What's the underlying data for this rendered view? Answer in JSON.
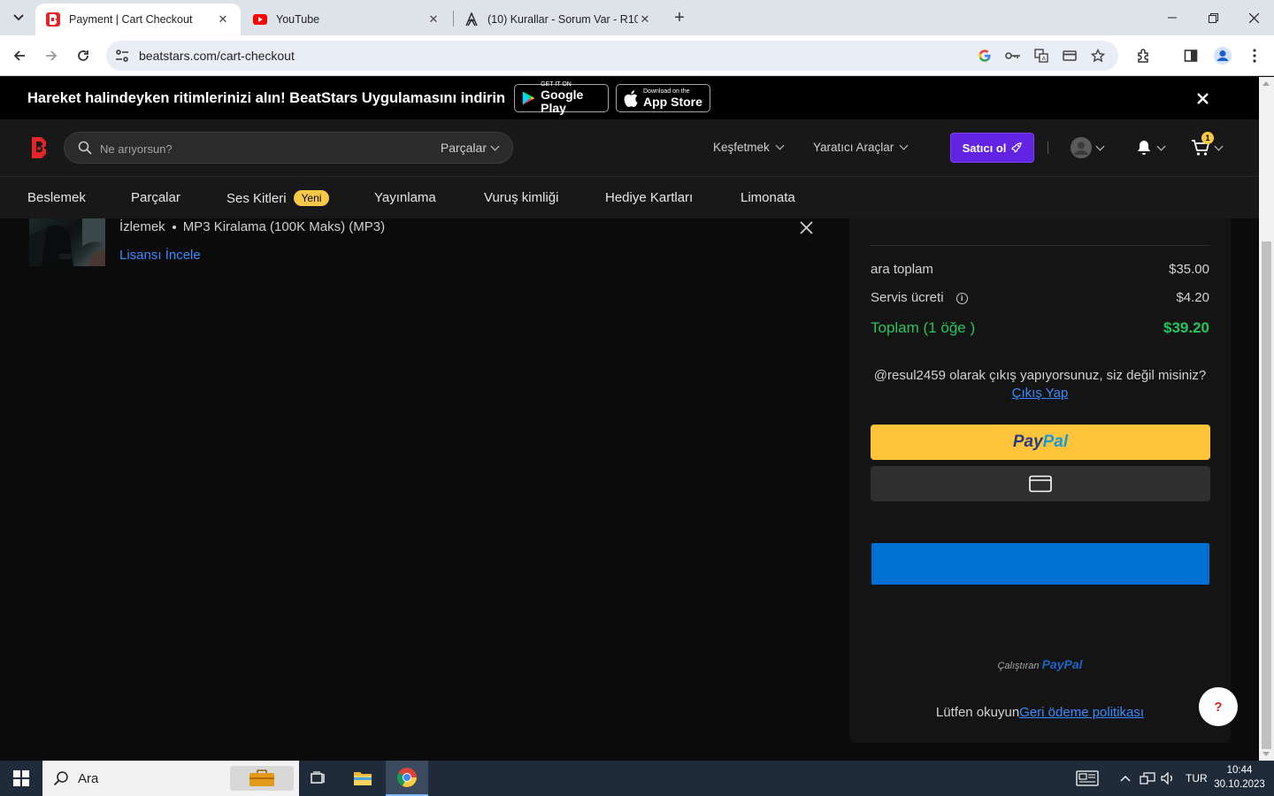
{
  "browser": {
    "tabs": [
      {
        "title": "Payment | Cart Checkout",
        "active": true
      },
      {
        "title": "YouTube",
        "active": false
      },
      {
        "title": "(10) Kurallar - Sorum Var - R10.",
        "active": false
      }
    ],
    "url": "beatstars.com/cart-checkout"
  },
  "promo": {
    "text": "Hareket halindeyken ritimlerinizi alın! BeatStars Uygulamasını indirin",
    "google_small": "GET IT ON",
    "google_big": "Google Play",
    "apple_small": "Download on the",
    "apple_big": "App Store"
  },
  "header": {
    "search_placeholder": "Ne arıyorsun?",
    "search_scope": "Parçalar",
    "explore": "Keşfetmek",
    "creator_tools": "Yaratıcı Araçlar",
    "seller_button": "Satıcı ol",
    "cart_count": "1"
  },
  "subnav": {
    "items": [
      "Beslemek",
      "Parçalar",
      "Ses Kitleri",
      "Yayınlama",
      "Vuruş kimliği",
      "Hediye Kartları",
      "Limonata"
    ],
    "new_badge": "Yeni"
  },
  "cart_item": {
    "type": "İzlemek",
    "license": "MP3 Kiralama (100K Maks) (MP3)",
    "review_link": "Lisansı İncele"
  },
  "summary": {
    "subtotal_label": "ara toplam",
    "subtotal_value": "$35.00",
    "fee_label": "Servis ücreti",
    "fee_value": "$4.20",
    "total_label": "Toplam (1 öğe )",
    "total_value": "$39.20",
    "logged_as": "@resul2459 olarak çıkış yapıyorsunuz, siz değil misiniz?",
    "logout_link": "Çıkış Yap",
    "paypal_label": "PayPal",
    "powered_by": "Çalıştıran",
    "powered_brand": "PayPal",
    "refund_text": "Lütfen okuyun",
    "refund_link": "Geri ödeme politikası"
  },
  "taskbar": {
    "search_label": "Ara",
    "lang": "TUR",
    "time": "10:44",
    "date": "30.10.2023"
  },
  "colors": {
    "accent_purple": "#6323e2",
    "total_green": "#22c55e",
    "paypal_yellow": "#ffc43a",
    "link_blue": "#3a8bff",
    "new_badge": "#f7c948"
  }
}
